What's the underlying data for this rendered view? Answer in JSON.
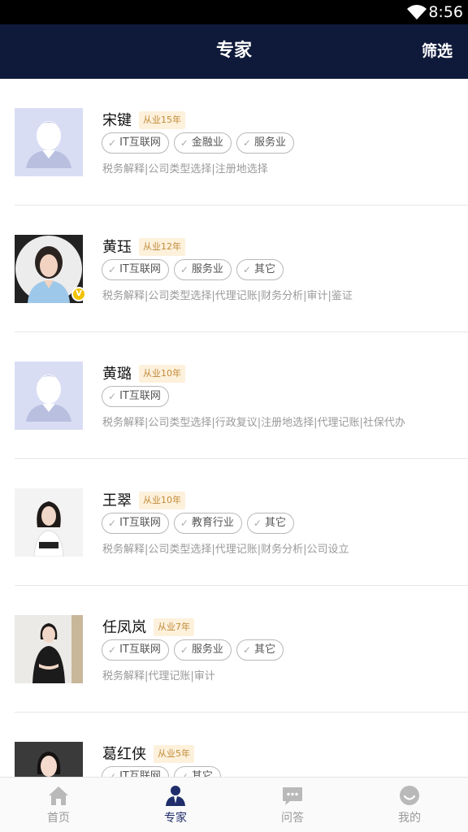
{
  "status_bar": {
    "time": "8:56"
  },
  "nav": {
    "title": "专家",
    "filter_label": "筛选"
  },
  "experts": [
    {
      "name": "宋键",
      "years": "从业15年",
      "tags": [
        "IT互联网",
        "金融业",
        "服务业"
      ],
      "services": "税务解释|公司类型选择|注册地选择",
      "avatar": "placeholder",
      "vip": false
    },
    {
      "name": "黄珏",
      "years": "从业12年",
      "tags": [
        "IT互联网",
        "服务业",
        "其它"
      ],
      "services": "税务解释|公司类型选择|代理记账|财务分析|审计|鉴证",
      "avatar": "photo-woman-blue",
      "vip": true
    },
    {
      "name": "黄璐",
      "years": "从业10年",
      "tags": [
        "IT互联网"
      ],
      "services": "税务解释|公司类型选择|行政复议|注册地选择|代理记账|社保代办",
      "avatar": "placeholder",
      "vip": false
    },
    {
      "name": "王翠",
      "years": "从业10年",
      "tags": [
        "IT互联网",
        "教育行业",
        "其它"
      ],
      "services": "税务解释|公司类型选择|代理记账|财务分析|公司设立",
      "avatar": "photo-woman-white",
      "vip": false
    },
    {
      "name": "任凤岚",
      "years": "从业7年",
      "tags": [
        "IT互联网",
        "服务业",
        "其它"
      ],
      "services": "税务解释|代理记账|审计",
      "avatar": "photo-woman-black",
      "vip": false
    },
    {
      "name": "葛红侠",
      "years": "从业5年",
      "tags": [
        "IT互联网",
        "其它"
      ],
      "services": "",
      "avatar": "photo-woman-dark",
      "vip": false
    }
  ],
  "tabs": [
    {
      "label": "首页",
      "icon": "home-icon",
      "active": false
    },
    {
      "label": "专家",
      "icon": "expert-icon",
      "active": true
    },
    {
      "label": "问答",
      "icon": "chat-icon",
      "active": false
    },
    {
      "label": "我的",
      "icon": "profile-icon",
      "active": false
    }
  ],
  "colors": {
    "navbar": "#0f1a3a",
    "active_tab": "#1f2d6a",
    "years_bg": "#fdf1dc",
    "years_text": "#c08a39",
    "vip": "#f2c200"
  }
}
